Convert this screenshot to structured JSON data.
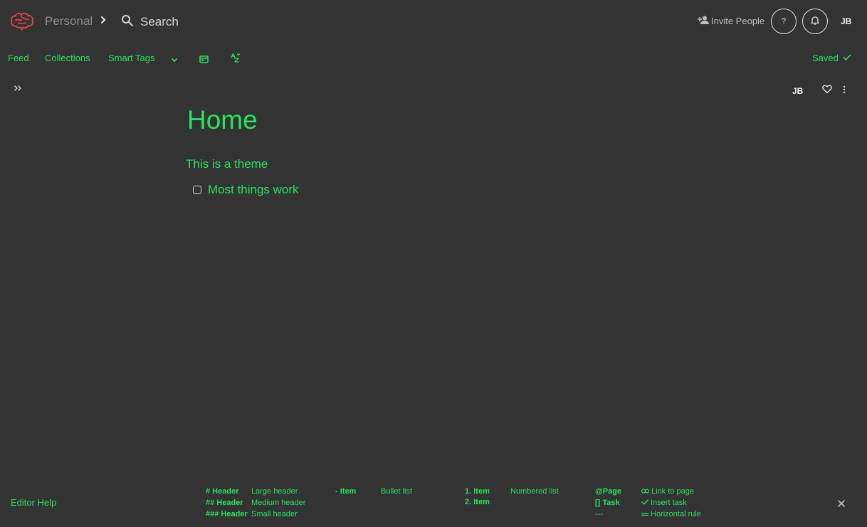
{
  "colors": {
    "background": "#333333",
    "accent": "#27e35e",
    "logo": "#e8404f",
    "muted": "#8e8e8e"
  },
  "header": {
    "logo_icon": "brain-icon",
    "workspace": "Personal",
    "search_label": "Search",
    "invite_label": "Invite People",
    "help_label": "?",
    "user_initials": "JB"
  },
  "nav": {
    "feed": "Feed",
    "collections": "Collections",
    "smart_tags": "Smart Tags",
    "saved_label": "Saved"
  },
  "page_toolbar": {
    "initials": "JB"
  },
  "page": {
    "title": "Home",
    "paragraph": "This is a theme",
    "task": {
      "text": "Most things work",
      "checked": false
    }
  },
  "editor_help": {
    "title": "Editor Help",
    "groups": [
      {
        "rows": [
          {
            "key": "# Header",
            "desc": "Large header"
          },
          {
            "key": "## Header",
            "desc": "Medium header"
          },
          {
            "key": "### Header",
            "desc": "Small header"
          }
        ]
      },
      {
        "rows": [
          {
            "key": "- Item",
            "desc": "Bullet list"
          }
        ]
      },
      {
        "rows": [
          {
            "key": "1. Item",
            "desc": "Numbered list"
          },
          {
            "key": "2. Item",
            "desc": ""
          }
        ]
      },
      {
        "rows": [
          {
            "key": "@Page",
            "desc": "Link to page",
            "icon": "link-icon"
          },
          {
            "key": "[] Task",
            "desc": "Insert task",
            "icon": "check-icon"
          },
          {
            "key": "---",
            "desc": "Horizontal rule",
            "icon": "rule-icon"
          }
        ]
      }
    ]
  }
}
